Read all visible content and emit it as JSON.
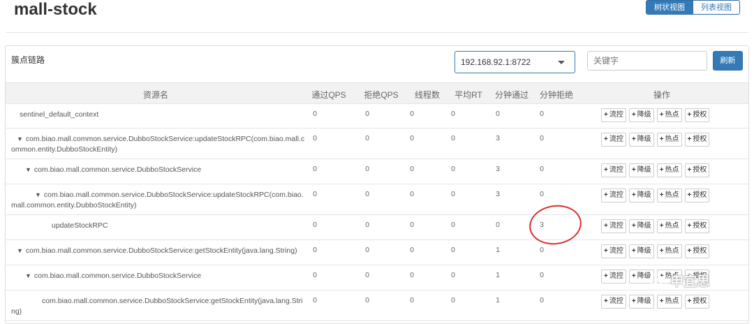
{
  "app": {
    "title": "mall-stock"
  },
  "view_toggle": {
    "tree_label": "树状视图",
    "list_label": "列表视图"
  },
  "panel": {
    "title": "簇点链路"
  },
  "machine": {
    "selected": "192.168.92.1:8722"
  },
  "search": {
    "placeholder": "关键字"
  },
  "refresh_label": "刷新",
  "columns": [
    "资源名",
    "通过QPS",
    "拒绝QPS",
    "线程数",
    "平均RT",
    "分钟通过",
    "分钟拒绝",
    "操作"
  ],
  "ops": [
    "流控",
    "降级",
    "热点",
    "授权"
  ],
  "rows": [
    {
      "tree": false,
      "name": "sentinel_default_context",
      "pass_qps": "0",
      "block_qps": "0",
      "threads": "0",
      "avg_rt": "0",
      "min_pass": "0",
      "min_block": "0"
    },
    {
      "tree": true,
      "name": "com.biao.mall.common.service.DubboStockService:updateStockRPC(com.biao.mall.c",
      "name2": "ommon.entity.DubboStockEntity)",
      "pass_qps": "0",
      "block_qps": "0",
      "threads": "0",
      "avg_rt": "0",
      "min_pass": "3",
      "min_block": "0"
    },
    {
      "tree": true,
      "name": "com.biao.mall.common.service.DubboStockService",
      "pass_qps": "0",
      "block_qps": "0",
      "threads": "0",
      "avg_rt": "0",
      "min_pass": "3",
      "min_block": "0"
    },
    {
      "tree": true,
      "name": "com.biao.mall.common.service.DubboStockService:updateStockRPC(com.biao.",
      "name2": "mall.common.entity.DubboStockEntity)",
      "pass_qps": "0",
      "block_qps": "0",
      "threads": "0",
      "avg_rt": "0",
      "min_pass": "3",
      "min_block": "0"
    },
    {
      "tree": false,
      "name": "updateStockRPC",
      "pass_qps": "0",
      "block_qps": "0",
      "threads": "0",
      "avg_rt": "0",
      "min_pass": "0",
      "min_block": "3"
    },
    {
      "tree": true,
      "name": "com.biao.mall.common.service.DubboStockService:getStockEntity(java.lang.String)",
      "pass_qps": "0",
      "block_qps": "0",
      "threads": "0",
      "avg_rt": "0",
      "min_pass": "1",
      "min_block": "0"
    },
    {
      "tree": true,
      "name": "com.biao.mall.common.service.DubboStockService",
      "pass_qps": "0",
      "block_qps": "0",
      "threads": "0",
      "avg_rt": "0",
      "min_pass": "1",
      "min_block": "0"
    },
    {
      "tree": false,
      "name": "com.biao.mall.common.service.DubboStockService:getStockEntity(java.lang.Stri",
      "name2": "ng)",
      "pass_qps": "0",
      "block_qps": "0",
      "threads": "0",
      "avg_rt": "0",
      "min_pass": "1",
      "min_block": "0"
    }
  ],
  "watermark": {
    "text": "申宜思"
  },
  "colors": {
    "primary": "#337ab7",
    "annotation": "#d9302a"
  }
}
